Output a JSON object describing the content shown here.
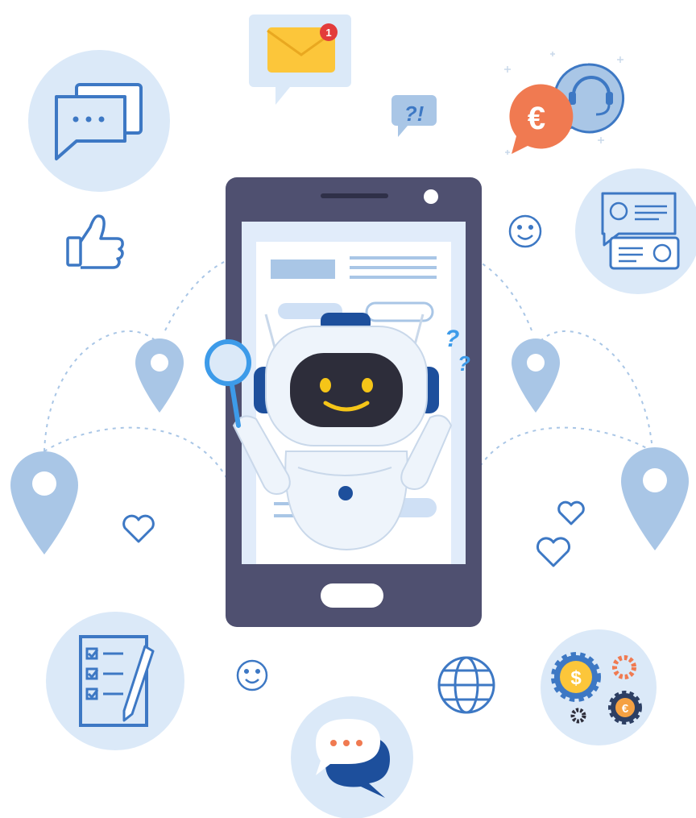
{
  "illustration": {
    "notification_badge": "1",
    "question_bubble_text": "?!",
    "currency_euro_symbol": "€",
    "currency_dollar_symbol": "$",
    "currency_coin_euro_symbol": "€"
  },
  "colors": {
    "circle_bg": "#dbe9f8",
    "icon_stroke": "#3d78c4",
    "phone_body": "#4f5070",
    "phone_screen": "#e1ecfa",
    "robot_face": "#2d2d3a",
    "robot_accent": "#1d4f9c",
    "pin_fill": "#a9c6e6",
    "envelope": "#fcc63a",
    "euro_bubble": "#f07a51",
    "badge": "#e33b3b",
    "robot_smile": "#f5c518"
  },
  "icons": [
    "chat-bubbles-icon",
    "envelope-notification-icon",
    "question-bubble-icon",
    "support-headset-icon",
    "euro-bubble-icon",
    "thumbs-up-icon",
    "smiley-icon",
    "contact-cards-icon",
    "location-pin-icon",
    "heart-icon",
    "checklist-icon",
    "globe-icon",
    "chat-dots-icon",
    "gears-currency-icon"
  ]
}
